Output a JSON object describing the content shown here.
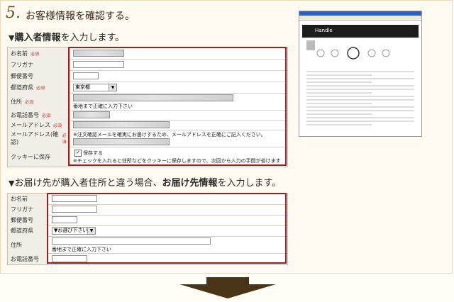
{
  "header": {
    "step_number": "5.",
    "title": "お客様情報を確認する。"
  },
  "buyer_section": {
    "heading_marker": "▼",
    "heading_bold": "購入者情報",
    "heading_rest": "を入力します。",
    "required_label": "必須",
    "rows": [
      {
        "label": "お名前",
        "required": true
      },
      {
        "label": "フリガナ",
        "required": false
      },
      {
        "label": "郵便番号",
        "required": false
      },
      {
        "label": "都道府県",
        "required": true
      },
      {
        "label": "住所",
        "required": true
      },
      {
        "label": "お電話番号",
        "required": true
      },
      {
        "label": "メールアドレス",
        "required": true
      },
      {
        "label": "メールアドレス(確認)",
        "required": true
      },
      {
        "label": "クッキーに保存",
        "required": false
      }
    ],
    "prefecture_value": "東京都",
    "address_note": "番地まで正確に入力下さい",
    "email_confirm_note": "※注文確認メールを確実にお届けするため、メールアドレスを正確にご記入ください。",
    "cookie_checkbox_label": "保存する",
    "cookie_checkbox_checked": true,
    "cookie_note": "※チェックを入れると住所などをクッキーに保存しますので、次回から入力の手間が省けます"
  },
  "delivery_section": {
    "heading_marker": "▼",
    "heading_pre": "お届け先が購入者住所と違う場合、",
    "heading_bold": "お届け先情報",
    "heading_rest": "を入力します。",
    "rows": [
      {
        "label": "お名前"
      },
      {
        "label": "フリガナ"
      },
      {
        "label": "郵便番号"
      },
      {
        "label": "都道府県"
      },
      {
        "label": "住所"
      },
      {
        "label": "お電話番号"
      }
    ],
    "prefecture_placeholder": "▼お選び下さい",
    "address_note": "番地まで正確に入力下さい"
  },
  "thumbnail": {
    "logo_text": "Handle"
  },
  "colors": {
    "highlight_border": "#a61b1b",
    "required_text": "#d9342b",
    "arrow": "#4a3418"
  }
}
